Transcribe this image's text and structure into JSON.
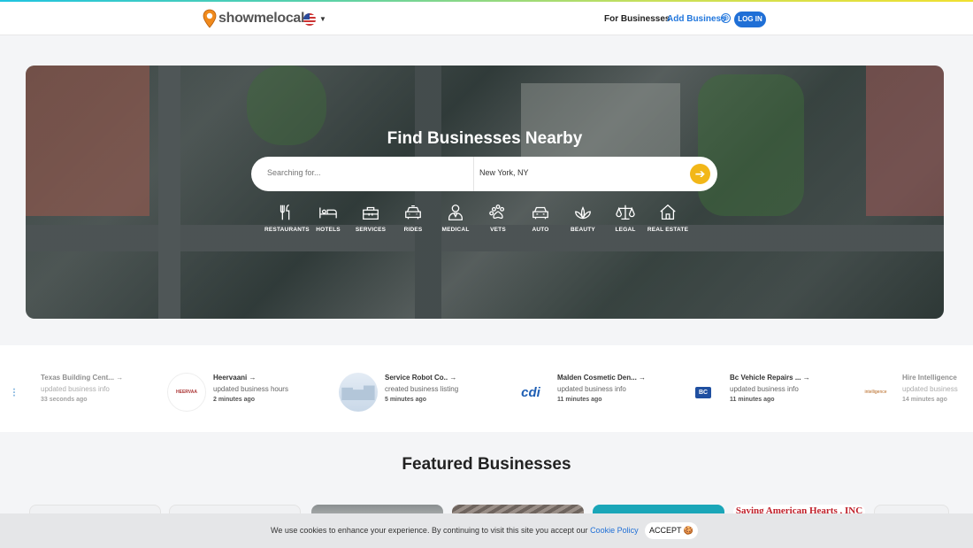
{
  "header": {
    "logo_text": "showmelocal",
    "logo_mark": "®",
    "nav_for_businesses": "For Businesses",
    "nav_add_business": "Add Business",
    "add_icon": "⊕",
    "login_label": "LOG IN",
    "flag_icon": "us-flag-icon"
  },
  "hero": {
    "title": "Find Businesses Nearby",
    "search_placeholder": "Searching for...",
    "location_value": "New York, NY",
    "go_icon": "arrow-right-icon"
  },
  "categories": [
    {
      "label": "RESTAURANTS",
      "icon": "fork-knife-icon"
    },
    {
      "label": "HOTELS",
      "icon": "bed-icon"
    },
    {
      "label": "SERVICES",
      "icon": "toolbox-icon"
    },
    {
      "label": "RIDES",
      "icon": "taxi-icon"
    },
    {
      "label": "MEDICAL",
      "icon": "doctor-icon"
    },
    {
      "label": "VETS",
      "icon": "paw-icon"
    },
    {
      "label": "AUTO",
      "icon": "car-icon"
    },
    {
      "label": "BEAUTY",
      "icon": "lotus-icon"
    },
    {
      "label": "LEGAL",
      "icon": "scales-icon"
    },
    {
      "label": "REAL ESTATE",
      "icon": "house-icon"
    }
  ],
  "activity": [
    {
      "name": "Texas Building Cent... →",
      "desc": "updated business info",
      "time": "33 seconds ago",
      "logo": ""
    },
    {
      "name": "Heervaani →",
      "desc": "updated business hours",
      "time": "2 minutes ago",
      "logo": "HEERVAA"
    },
    {
      "name": "Service Robot Co.. →",
      "desc": "created business listing",
      "time": "5 minutes ago",
      "logo": ""
    },
    {
      "name": "Malden Cosmetic Den... →",
      "desc": "updated business info",
      "time": "11 minutes ago",
      "logo": "cdi"
    },
    {
      "name": "Bc Vehicle Repairs ... →",
      "desc": "updated business info",
      "time": "11 minutes ago",
      "logo": "BC"
    },
    {
      "name": "Hire Intelligence",
      "desc": "updated business",
      "time": "14 minutes ago",
      "logo": "intelligence"
    }
  ],
  "featured": {
    "title": "Featured Businesses",
    "card_text": "Saving American Hearts , INC"
  },
  "cookie": {
    "text": "We use cookies to enhance your experience. By continuing to visit this site you accept our",
    "link": "Cookie Policy",
    "accept_label": "ACCEPT 🍪"
  },
  "colors": {
    "brand_blue": "#1f6fd6",
    "accent_yellow": "#f2b718",
    "card_red": "#c0202a"
  }
}
